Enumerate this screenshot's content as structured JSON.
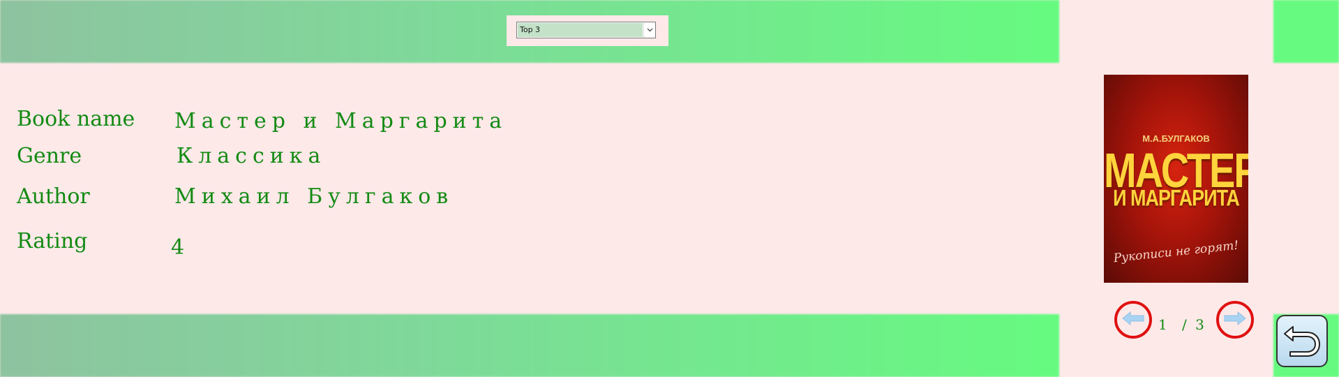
{
  "filter": {
    "selected": "Top 3"
  },
  "book": {
    "name_label": "Book name",
    "name_value": "Мастер и Маргарита",
    "genre_label": "Genre",
    "genre_value": "Классика",
    "author_label": "Author",
    "author_value": "Михаил Булгаков",
    "rating_label": "Rating",
    "rating_value": "4"
  },
  "cover": {
    "author": "М.А.БУЛГАКОВ",
    "title_line1": "МАСТЕР",
    "title_line2": "И МАРГАРИТА",
    "tagline": "Рукописи не горят!"
  },
  "pagination": {
    "current": "1",
    "total": "/ 3"
  },
  "icons": {
    "prev": "arrow-left-icon",
    "next": "arrow-right-icon",
    "back": "return-icon",
    "dropdown": "chevron-down-icon"
  },
  "colors": {
    "text": "#138a13",
    "nav_ring": "#e01010",
    "band": "#66fb80",
    "background": "#fce9e8"
  }
}
